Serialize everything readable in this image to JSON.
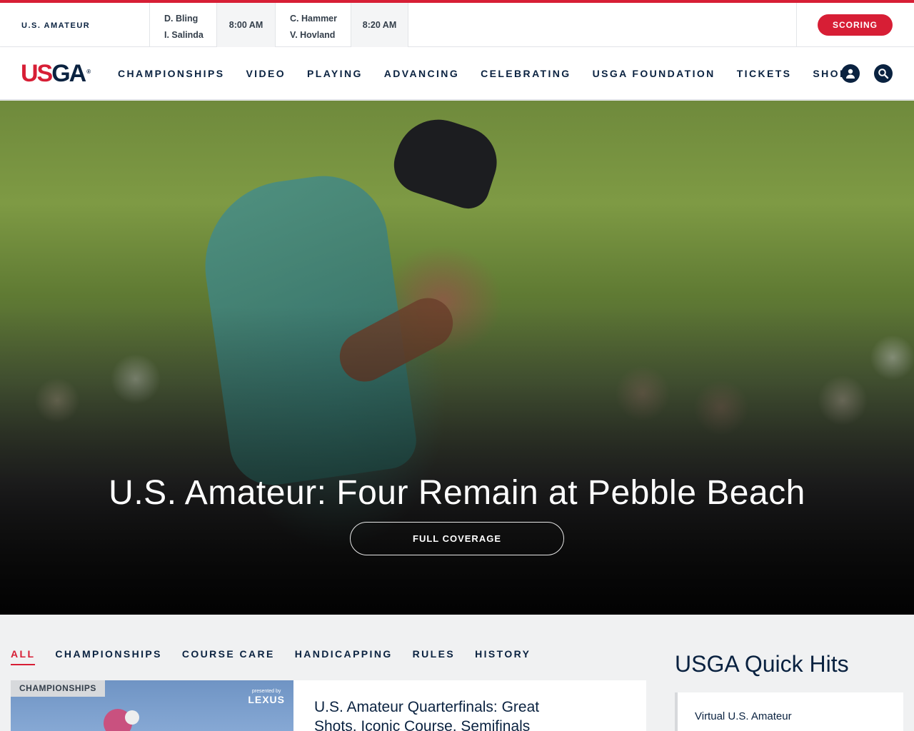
{
  "ticker": {
    "championship": "U.S. AMATEUR",
    "pairings": [
      {
        "player1": "D. Bling",
        "player2": "I. Salinda",
        "time": "8:00 AM"
      },
      {
        "player1": "C. Hammer",
        "player2": "V. Hovland",
        "time": "8:20 AM"
      }
    ],
    "scoring_label": "SCORING"
  },
  "brand": {
    "logo_us": "US",
    "logo_ga": "GA",
    "logo_reg": "®",
    "colors": {
      "red": "#d71e35",
      "navy": "#0a2240"
    }
  },
  "nav": {
    "items": [
      "CHAMPIONSHIPS",
      "VIDEO",
      "PLAYING",
      "ADVANCING",
      "CELEBRATING",
      "USGA FOUNDATION",
      "TICKETS",
      "SHOP"
    ],
    "icons": [
      "user-icon",
      "search-icon"
    ]
  },
  "hero": {
    "title": "U.S. Amateur: Four Remain at Pebble Beach",
    "button": "FULL COVERAGE"
  },
  "filters": {
    "items": [
      "ALL",
      "CHAMPIONSHIPS",
      "COURSE CARE",
      "HANDICAPPING",
      "RULES",
      "HISTORY"
    ],
    "active": "ALL"
  },
  "card": {
    "tag": "CHAMPIONSHIPS",
    "sponsor_pre": "presented by",
    "sponsor_brand": "LEXUS",
    "title": "U.S. Amateur Quarterfinals: Great Shots, Iconic Course, Semifinals"
  },
  "quick_hits": {
    "title": "USGA Quick Hits",
    "items": [
      "Virtual U.S. Amateur"
    ]
  }
}
